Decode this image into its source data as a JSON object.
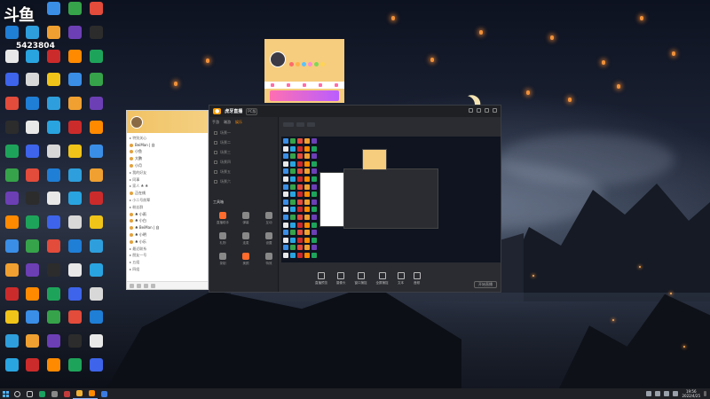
{
  "overlay": {
    "logo_text": "斗鱼",
    "room_number": "5423804"
  },
  "desktop_icons": [
    {
      "label": "",
      "color": "#3a8ee6"
    },
    {
      "label": "",
      "color": "#36a34a"
    },
    {
      "label": "",
      "color": "#e34b3b"
    },
    {
      "label": "",
      "color": "#1f7ed6"
    },
    {
      "label": "",
      "color": "#2e9fdc"
    },
    {
      "label": "",
      "color": "#f0a030"
    },
    {
      "label": "",
      "color": "#6c3fb5"
    },
    {
      "label": "",
      "color": "#2c2c2c"
    },
    {
      "label": "",
      "color": "#e8e8e8"
    },
    {
      "label": "",
      "color": "#29a4e0"
    },
    {
      "label": "",
      "color": "#cc2b2b"
    },
    {
      "label": "",
      "color": "#ff8a00"
    },
    {
      "label": "",
      "color": "#1ea45a"
    },
    {
      "label": "",
      "color": "#3d64ea"
    },
    {
      "label": "",
      "color": "#d8d8d8"
    },
    {
      "label": "",
      "color": "#f0c419"
    }
  ],
  "qq_window": {
    "rows": [
      {
        "text": "▸ 特别关心",
        "kind": "group"
      },
      {
        "text": "BeiMan | 自",
        "kind": "contact"
      },
      {
        "text": "小鱼",
        "kind": "contact"
      },
      {
        "text": "大鹏",
        "kind": "contact"
      },
      {
        "text": "小月",
        "kind": "contact"
      },
      {
        "text": "▸ 我的好友",
        "kind": "group"
      },
      {
        "text": "▸ 同事",
        "kind": "group"
      },
      {
        "text": "▸ 家人 ♣ ♣",
        "kind": "group"
      },
      {
        "text": "正在线",
        "kind": "contact"
      },
      {
        "text": "▸ 小二号前辈",
        "kind": "group"
      },
      {
        "text": "▸ 粉丝群",
        "kind": "group"
      },
      {
        "text": "♣ 小雨",
        "kind": "contact"
      },
      {
        "text": "♣ 小白",
        "kind": "contact"
      },
      {
        "text": "♣ BeiMan | 自",
        "kind": "contact"
      },
      {
        "text": "♣ 小明",
        "kind": "contact"
      },
      {
        "text": "♣ 小乐",
        "kind": "contact"
      },
      {
        "text": "▸ 最近联系",
        "kind": "group"
      },
      {
        "text": "▸ 朋友一号",
        "kind": "group"
      },
      {
        "text": "▸ 五组",
        "kind": "group"
      },
      {
        "text": "▸ 四组",
        "kind": "group"
      }
    ]
  },
  "huya_app": {
    "brand": "虎牙直播",
    "version": "PC版",
    "sidebar_tabs": [
      "手游",
      "端游",
      "娱乐"
    ],
    "scenes": [
      "场景一",
      "场景二",
      "场景三",
      "场景四",
      "场景五",
      "场景六"
    ],
    "tools_title": "工具箱",
    "tools": [
      {
        "label": "直播助手",
        "color": "#ff6b2c"
      },
      {
        "label": "弹幕",
        "color": "#888888"
      },
      {
        "label": "互动",
        "color": "#888888"
      },
      {
        "label": "礼物",
        "color": "#888888"
      },
      {
        "label": "连麦",
        "color": "#888888"
      },
      {
        "label": "设置",
        "color": "#888888"
      },
      {
        "label": "录制",
        "color": "#888888"
      },
      {
        "label": "美颜",
        "color": "#ff6b2c"
      },
      {
        "label": "特效",
        "color": "#888888"
      }
    ],
    "bottom_buttons": [
      "直播预览",
      "摄像头",
      "窗口捕捉",
      "全屏捕捉",
      "文本",
      "音频"
    ],
    "start_label": "开始直播"
  },
  "taskbar": {
    "clock_time": "19:56",
    "clock_date": "2022/4/25"
  }
}
